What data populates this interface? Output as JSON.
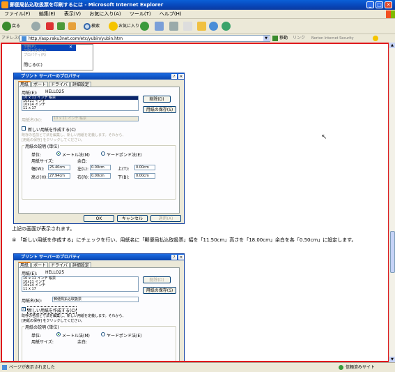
{
  "window": {
    "title": "郵便局払込取扱票を印刷するには - Microsoft Internet Explorer",
    "min": "_",
    "max": "□",
    "close": "✕"
  },
  "menu": [
    "ファイル(F)",
    "編集(E)",
    "表示(V)",
    "お気に入り(A)",
    "ツール(T)",
    "ヘルプ(H)"
  ],
  "toolbar": {
    "back": "戻る",
    "search": "検索",
    "favorites": "お気に入り"
  },
  "address": {
    "label": "アドレス(D)",
    "url": "http://asp.raku3net.com/etc/yubin/yubin.htm",
    "go": "移動",
    "links": "リンク",
    "norton": "Norton Internet Security"
  },
  "popup": {
    "items": [
      "印刷(P)",
      "印刷の設定(U)",
      "プロパティ(R)",
      "閉じる(C)"
    ]
  },
  "dialog1": {
    "title": "プリント サーバーのプロパティ",
    "help": "?",
    "close": "✕",
    "tabs": [
      "用紙",
      "ポート",
      "ドライバ",
      "詳細設定"
    ],
    "forms_on": "用紙(E):",
    "server": "HELLO25",
    "list": [
      "10 x 11 インチ 帳票",
      "10x11 インチ",
      "10x14 インチ",
      "11 x 17"
    ],
    "delete": "削除(D)",
    "save": "用紙の保存(S)",
    "formname_label": "用紙名(N):",
    "formname": "10 x 11 インチ 帳票",
    "create_new": "新しい用紙を作成する(C)",
    "hint": "既存の名前と寸法を編集し、新しい用紙を定義します。それから、[用紙の保存] をクリックしてください。",
    "desc": "用紙の説明 (単位)",
    "units": "単位:",
    "metric": "メートル法(M)",
    "english": "ヤードポンド法(E)",
    "paper_size": "用紙サイズ:",
    "margins": "余白:",
    "width_label": "幅(W):",
    "width": "25.40cm",
    "height_label": "高さ(H):",
    "height": "27.94cm",
    "left_label": "左(L):",
    "left": "0.00cm",
    "right_label": "右(R):",
    "right": "0.00cm",
    "top_label": "上(T):",
    "top": "0.00cm",
    "bottom_label": "下(B):",
    "bottom": "0.00cm",
    "ok": "OK",
    "cancel": "キャンセル",
    "apply": "適用(A)"
  },
  "text1": "上記の画面が表示されます。",
  "text2": "④ 「新しい用紙を作成する」にチェックを行い、用紙名に「郵便局払込取扱票」幅を「11.50cm」高さを「18.00cm」余白を各「0.50cm」に設定します。",
  "dialog2": {
    "title": "プリント サーバーのプロパティ",
    "formname": "郵便局払込取扱票",
    "hint": "既存の名前と寸法を編集し、新しい用紙を定義します。それから、[用紙の保存] をクリックしてください。"
  },
  "status": {
    "text": "ページが表示されました",
    "zone": "信頼済みサイト"
  },
  "colors": {
    "accent": "#e0191d",
    "titlebar": "#0846b8"
  }
}
